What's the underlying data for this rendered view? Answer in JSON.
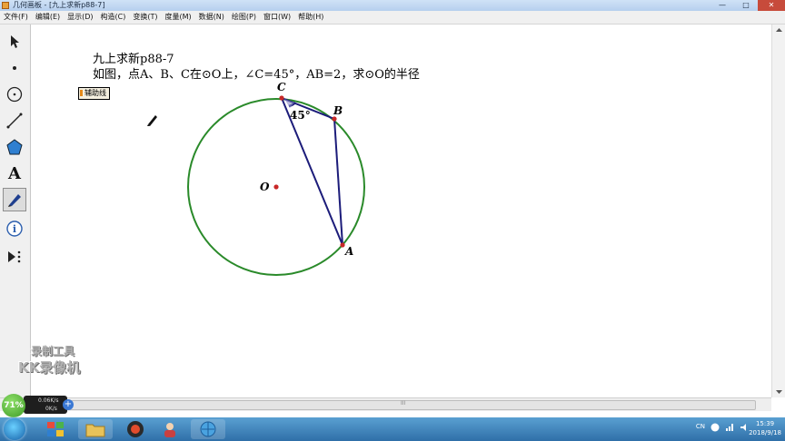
{
  "window": {
    "title": "几何画板 - [九上求新p88-7]",
    "controls": [
      "—",
      "□",
      "✕"
    ]
  },
  "menu": [
    "文件(F)",
    "编辑(E)",
    "显示(D)",
    "构造(C)",
    "变换(T)",
    "度量(M)",
    "数据(N)",
    "绘图(P)",
    "窗口(W)",
    "帮助(H)"
  ],
  "toolbar": {
    "tools": [
      "selection-arrow",
      "point",
      "compass",
      "straightedge",
      "polygon",
      "text",
      "marker",
      "information",
      "custom-tools"
    ],
    "active": "marker",
    "text_tool_glyph": "A",
    "info_glyph": "i"
  },
  "problem": {
    "title": "九上求新p88-7",
    "text": "如图，点A、B、C在⊙O上，∠C=45°，AB=2，求⊙O的半径"
  },
  "aux_button": "辅助线",
  "figure": {
    "labels": {
      "C": "C",
      "B": "B",
      "A": "A",
      "O": "O"
    },
    "angle": "45°",
    "colors": {
      "circle": "#2a8a2a",
      "segments": "#1c1c7a",
      "points": "#c82828"
    }
  },
  "watermark": [
    "录制工具",
    "KK录像机"
  ],
  "network_widget": {
    "percent": "71%",
    "up": "0.06K/s",
    "down": "0K/s",
    "add": "+"
  },
  "scrollbar": {
    "grip": "III"
  },
  "taskbar": {
    "tray": [
      "CN"
    ],
    "time": "15:39",
    "date": "2018/9/18"
  }
}
